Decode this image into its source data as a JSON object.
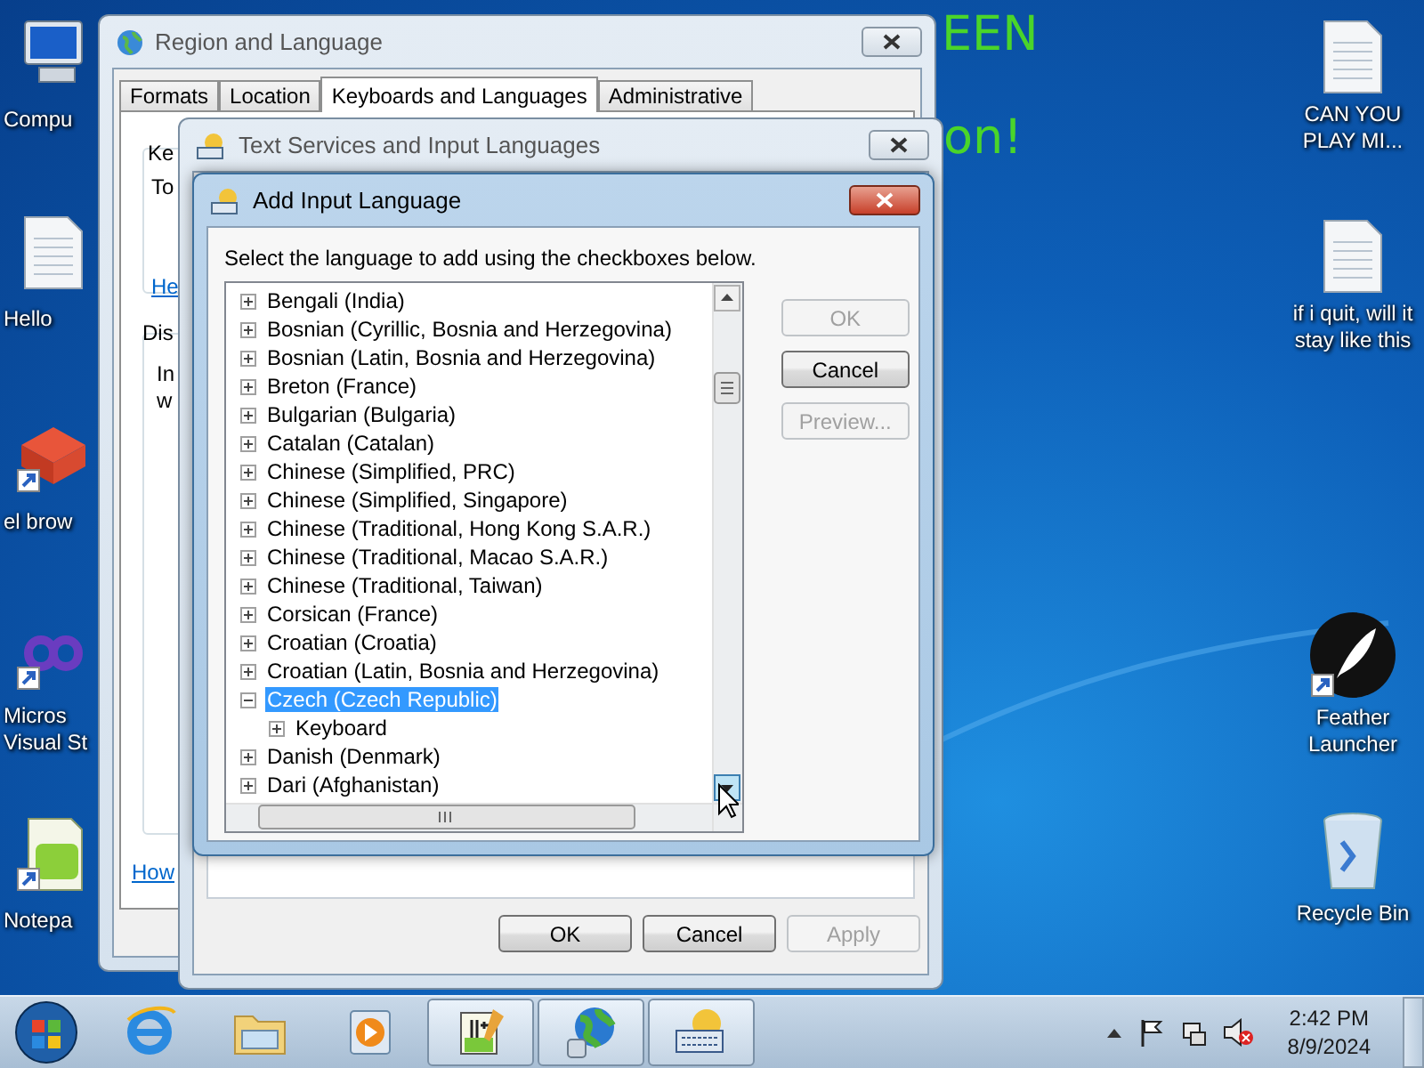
{
  "desktop": {
    "banner": [
      "EEN",
      "on!"
    ],
    "left_icons": [
      {
        "label": "Compu",
        "kind": "computer"
      },
      {
        "label": "Hello",
        "kind": "document"
      },
      {
        "label": "el brow",
        "kind": "cube"
      },
      {
        "label": "Micros\nVisual St",
        "kind": "infinity"
      },
      {
        "label": "Notepa",
        "kind": "notepad"
      }
    ],
    "right_icons": [
      {
        "label": "CAN YOU PLAY MI...",
        "kind": "document"
      },
      {
        "label": "if i quit, will it stay like this",
        "kind": "document"
      },
      {
        "label": "Feather Launcher",
        "kind": "feather"
      },
      {
        "label": "Recycle Bin",
        "kind": "recycle"
      }
    ]
  },
  "region_window": {
    "title": "Region and Language",
    "tabs": [
      {
        "label": "Formats",
        "selected": false
      },
      {
        "label": "Location",
        "selected": false
      },
      {
        "label": "Keyboards and Languages",
        "selected": true
      },
      {
        "label": "Administrative",
        "selected": false
      }
    ],
    "fragments": [
      {
        "text": "Ke",
        "kind": "label"
      },
      {
        "text": "To",
        "kind": "label"
      },
      {
        "text": "He",
        "kind": "link"
      },
      {
        "text": "Dis",
        "kind": "label"
      },
      {
        "text": "In",
        "kind": "label"
      },
      {
        "text": "w",
        "kind": "label"
      },
      {
        "text": "How",
        "kind": "link"
      }
    ]
  },
  "text_services_window": {
    "title": "Text Services and Input Languages",
    "buttons": [
      {
        "label": "OK",
        "disabled": false
      },
      {
        "label": "Cancel",
        "disabled": false
      },
      {
        "label": "Apply",
        "disabled": true
      }
    ]
  },
  "add_language_dialog": {
    "title": "Add Input Language",
    "instruction": "Select the language to add using the checkboxes below.",
    "languages": [
      {
        "label": "Bengali (India)",
        "expanded": false,
        "selected": false
      },
      {
        "label": "Bosnian (Cyrillic, Bosnia and Herzegovina)",
        "expanded": false,
        "selected": false
      },
      {
        "label": "Bosnian (Latin, Bosnia and Herzegovina)",
        "expanded": false,
        "selected": false
      },
      {
        "label": "Breton (France)",
        "expanded": false,
        "selected": false
      },
      {
        "label": "Bulgarian (Bulgaria)",
        "expanded": false,
        "selected": false
      },
      {
        "label": "Catalan (Catalan)",
        "expanded": false,
        "selected": false
      },
      {
        "label": "Chinese (Simplified, PRC)",
        "expanded": false,
        "selected": false
      },
      {
        "label": "Chinese (Simplified, Singapore)",
        "expanded": false,
        "selected": false
      },
      {
        "label": "Chinese (Traditional, Hong Kong S.A.R.)",
        "expanded": false,
        "selected": false
      },
      {
        "label": "Chinese (Traditional, Macao S.A.R.)",
        "expanded": false,
        "selected": false
      },
      {
        "label": "Chinese (Traditional, Taiwan)",
        "expanded": false,
        "selected": false
      },
      {
        "label": "Corsican (France)",
        "expanded": false,
        "selected": false
      },
      {
        "label": "Croatian (Croatia)",
        "expanded": false,
        "selected": false
      },
      {
        "label": "Croatian (Latin, Bosnia and Herzegovina)",
        "expanded": false,
        "selected": false
      },
      {
        "label": "Czech (Czech Republic)",
        "expanded": true,
        "selected": true,
        "children": [
          {
            "label": "Keyboard",
            "expanded": false,
            "selected": false
          }
        ]
      },
      {
        "label": "Danish (Denmark)",
        "expanded": false,
        "selected": false
      },
      {
        "label": "Dari (Afghanistan)",
        "expanded": false,
        "selected": false
      }
    ],
    "buttons": [
      {
        "label": "OK",
        "disabled": true
      },
      {
        "label": "Cancel",
        "disabled": false
      },
      {
        "label": "Preview...",
        "disabled": true
      }
    ]
  },
  "taskbar": {
    "apps": [
      {
        "kind": "browser",
        "running": false
      },
      {
        "kind": "folder",
        "running": false
      },
      {
        "kind": "media",
        "running": false
      },
      {
        "kind": "notepad",
        "running": true
      },
      {
        "kind": "globe",
        "running": true
      },
      {
        "kind": "keyboard",
        "running": true
      }
    ],
    "clock": {
      "time": "2:42 PM",
      "date": "8/9/2024"
    }
  }
}
